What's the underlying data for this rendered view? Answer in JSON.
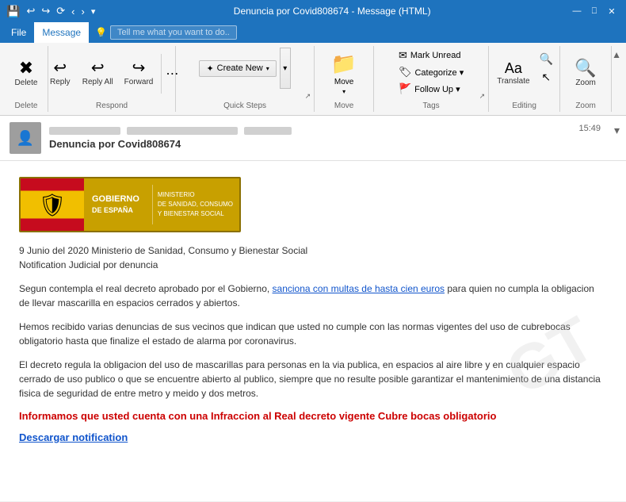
{
  "window": {
    "title": "Denuncia por Covid808674 - Message (HTML)",
    "controls": [
      "minimize",
      "restore",
      "close"
    ]
  },
  "menu": {
    "items": [
      "File",
      "Message"
    ],
    "active": "Message",
    "tell_me_placeholder": "Tell me what you want to do..."
  },
  "ribbon": {
    "groups": {
      "delete": {
        "label": "Delete",
        "buttons": [
          {
            "icon": "✖",
            "label": "Delete"
          }
        ]
      },
      "respond": {
        "label": "Respond",
        "buttons": [
          {
            "icon": "↩",
            "label": "Reply"
          },
          {
            "icon": "↩↩",
            "label": "Reply All"
          },
          {
            "icon": "→",
            "label": "Forward"
          }
        ]
      },
      "quicksteps": {
        "label": "Quick Steps",
        "buttons": [
          {
            "icon": "✦",
            "label": "Create New"
          }
        ]
      },
      "move": {
        "label": "Move",
        "buttons": [
          {
            "icon": "📁",
            "label": "Move"
          }
        ]
      },
      "tags": {
        "label": "Tags",
        "buttons": [
          {
            "icon": "✉",
            "label": "Mark Unread"
          },
          {
            "icon": "🏷",
            "label": "Categorize"
          },
          {
            "icon": "🚩",
            "label": "Follow Up -"
          }
        ]
      },
      "editing": {
        "label": "Editing",
        "buttons": [
          {
            "icon": "Aa",
            "label": "Translate"
          }
        ]
      },
      "zoom": {
        "label": "Zoom",
        "buttons": [
          {
            "icon": "🔍",
            "label": "Zoom"
          }
        ]
      }
    }
  },
  "email": {
    "subject": "Denuncia por Covid808674",
    "time": "15:49",
    "body": {
      "date_line": "9 Junio del 2020 Ministerio de Sanidad, Consumo y Bienestar Social",
      "notification_line": "Notification Judicial por denuncia",
      "para1_before": "Segun contempla el real decreto aprobado por el Gobierno, ",
      "para1_link": "sanciona con multas de hasta cien euros",
      "para1_after": " para quien no cumpla la obligacion de llevar mascarilla en espacios cerrados y abiertos.",
      "para2": "Hemos recibido varias denuncias de sus vecinos que indican que usted no cumple con las normas vigentes del uso de cubrebocas obligatorio hasta que finalize el estado de alarma por coronavirus.",
      "para3": "El decreto regula la obligacion del uso de mascarillas para personas en la via publica, en espacios al aire libre y en cualquier espacio cerrado de uso publico o que se encuentre abierto al publico, siempre que no resulte posible garantizar el mantenimiento de una distancia fisica de seguridad de entre metro y meido y dos metros.",
      "warning": "Informamos que usted cuenta con una Infraccion al Real decreto vigente Cubre bocas obligatorio",
      "download_link": "Descargar notification"
    }
  }
}
